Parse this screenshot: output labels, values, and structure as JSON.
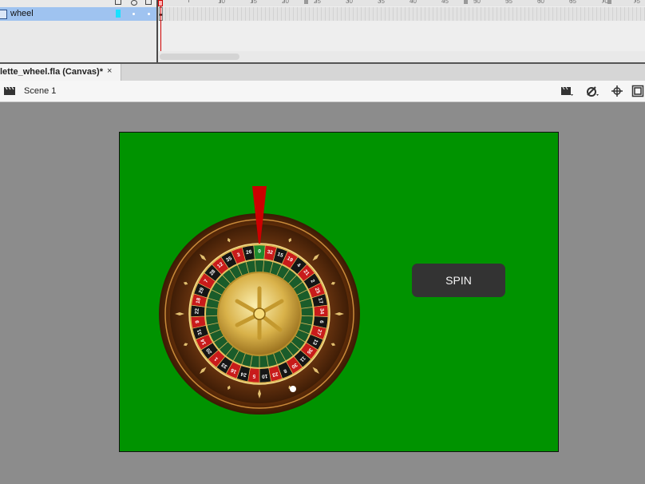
{
  "timeline": {
    "layer_name": "wheel",
    "ruler_labels": [
      "10",
      "15",
      "20",
      "25",
      "30",
      "35",
      "40",
      "45",
      "50",
      "55",
      "60",
      "65",
      "70",
      "75"
    ],
    "layer_color": "#19e0ff"
  },
  "document": {
    "tab_label": "lette_wheel.fla (Canvas)*",
    "close_glyph": "×"
  },
  "editbar": {
    "scene_label": "Scene 1"
  },
  "stage": {
    "background": "#009300",
    "spin_label": "SPIN",
    "wheel_numbers": [
      "0",
      "32",
      "15",
      "19",
      "4",
      "21",
      "2",
      "25",
      "17",
      "34",
      "6",
      "27",
      "13",
      "36",
      "11",
      "30",
      "8",
      "23",
      "10",
      "5",
      "24",
      "16",
      "33",
      "1",
      "20",
      "14",
      "31",
      "9",
      "22",
      "18",
      "29",
      "7",
      "28",
      "12",
      "35",
      "3",
      "26"
    ]
  },
  "icons": [
    "layer-icon",
    "clapperboard-icon",
    "symbol-edit-icon",
    "snap-icon",
    "fit-stage-icon",
    "close-icon"
  ]
}
